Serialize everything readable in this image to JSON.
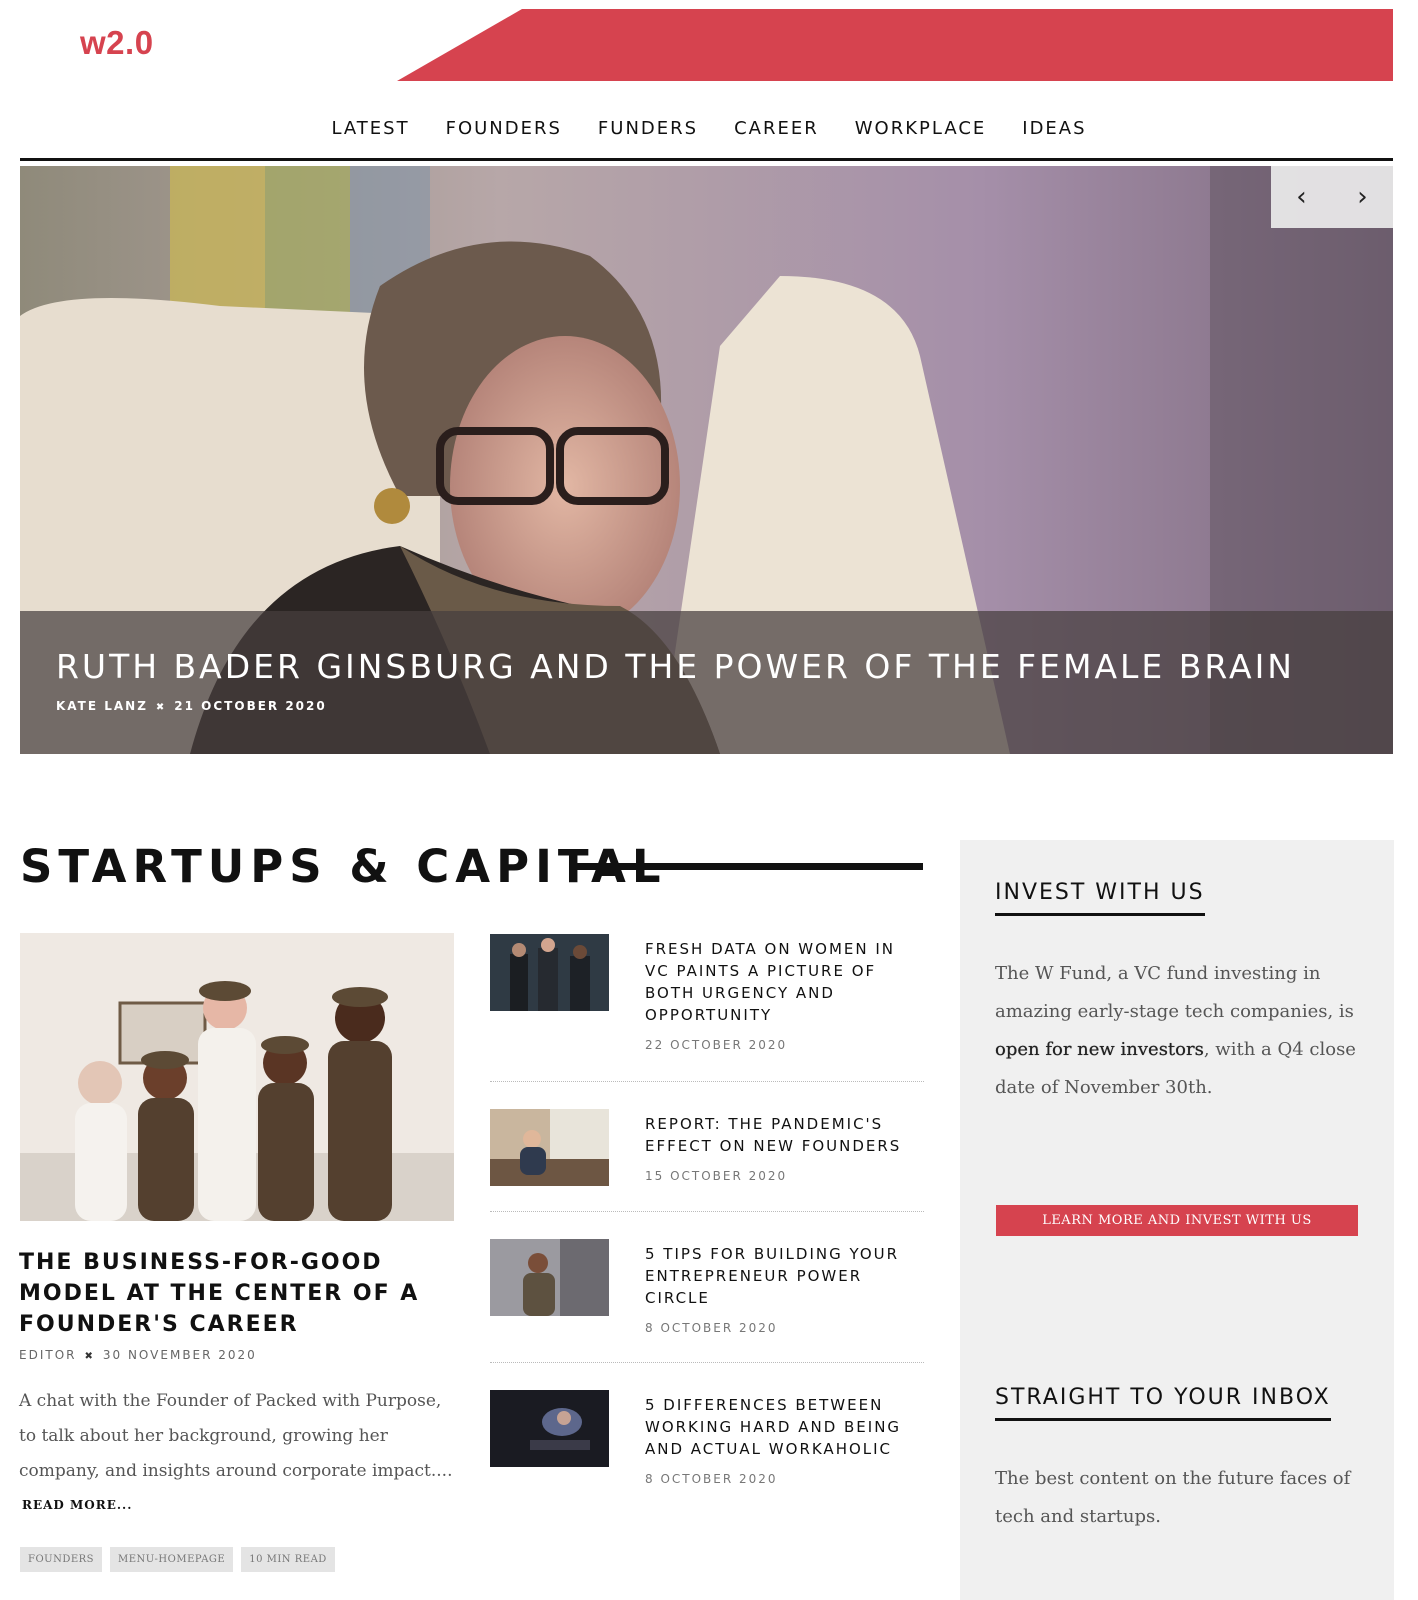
{
  "brand": {
    "logo": "w2.0",
    "accent_color": "#d6434f"
  },
  "nav": {
    "items": [
      {
        "label": "LATEST"
      },
      {
        "label": "FOUNDERS"
      },
      {
        "label": "FUNDERS"
      },
      {
        "label": "CAREER"
      },
      {
        "label": "WORKPLACE"
      },
      {
        "label": "IDEAS"
      }
    ]
  },
  "hero": {
    "title": "RUTH BADER GINSBURG AND THE POWER OF THE FEMALE BRAIN",
    "author": "KATE LANZ",
    "separator": "✖",
    "date": "21 OCTOBER 2020",
    "prev_icon": "‹",
    "next_icon": "›"
  },
  "section": {
    "title": "STARTUPS & CAPITAL"
  },
  "feature": {
    "title": "THE BUSINESS-FOR-GOOD MODEL AT THE CENTER OF A FOUNDER'S CAREER",
    "author": "EDITOR",
    "separator": "✖",
    "date": "30 NOVEMBER 2020",
    "excerpt": "A chat with the Founder of Packed with Purpose, to talk about her background, growing her company, and insights around corporate impact....",
    "read_more": "READ MORE...",
    "tags": [
      "FOUNDERS",
      "MENU-HOMEPAGE",
      "10 MIN READ"
    ]
  },
  "articles": [
    {
      "title": "FRESH DATA ON WOMEN IN VC PAINTS A PICTURE OF BOTH URGENCY AND OPPORTUNITY",
      "date": "22 OCTOBER 2020"
    },
    {
      "title": "REPORT: THE PANDEMIC'S EFFECT ON NEW FOUNDERS",
      "date": "15 OCTOBER 2020"
    },
    {
      "title": "5 TIPS FOR BUILDING YOUR ENTREPRENEUR POWER CIRCLE",
      "date": "8 OCTOBER 2020"
    },
    {
      "title": "5 DIFFERENCES BETWEEN WORKING HARD AND BEING AND ACTUAL WORKAHOLIC",
      "date": "8 OCTOBER 2020"
    }
  ],
  "sidebar": {
    "invest": {
      "heading": "INVEST WITH US",
      "text_before": "The W Fund, a VC fund investing in amazing early-stage tech companies, is ",
      "text_bold": "open for new investors",
      "text_after": ", with a Q4 close date of November 30th.",
      "button": "LEARN MORE AND INVEST WITH US"
    },
    "inbox": {
      "heading": "STRAIGHT TO YOUR INBOX",
      "text": "The best content on the future faces of tech and startups."
    }
  }
}
